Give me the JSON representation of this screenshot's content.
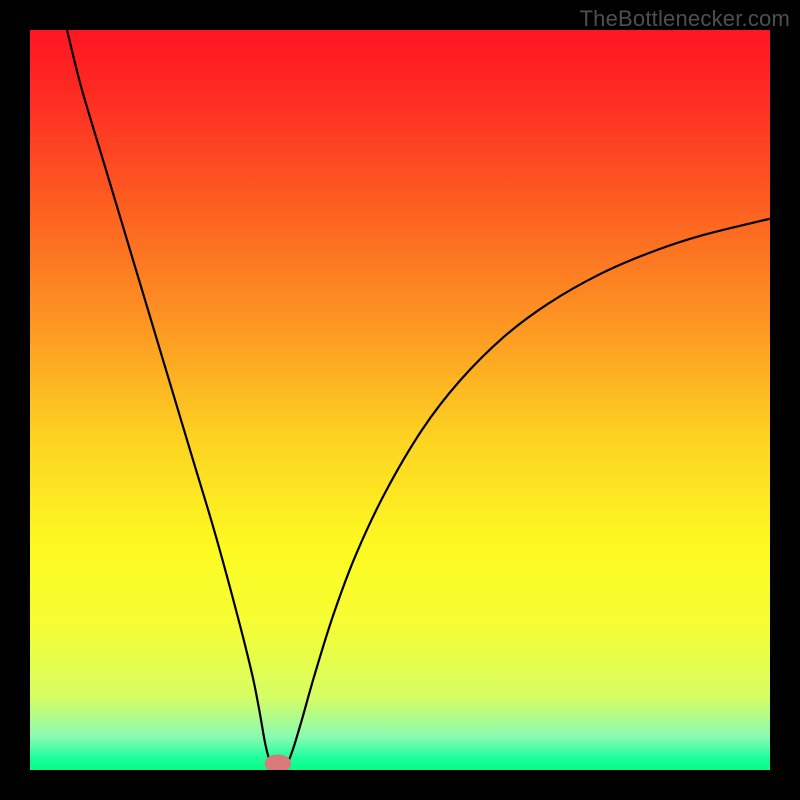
{
  "watermark": "TheBottlenecker.com",
  "chart_data": {
    "type": "line",
    "title": "",
    "xlabel": "",
    "ylabel": "",
    "xlim": [
      0,
      100
    ],
    "ylim": [
      0,
      100
    ],
    "background_gradient": {
      "stops": [
        {
          "offset": 0.0,
          "color": "#fe1522"
        },
        {
          "offset": 0.1,
          "color": "#fe2f22"
        },
        {
          "offset": 0.25,
          "color": "#fd6321"
        },
        {
          "offset": 0.4,
          "color": "#fd9722"
        },
        {
          "offset": 0.55,
          "color": "#fdd222"
        },
        {
          "offset": 0.7,
          "color": "#fdfa22"
        },
        {
          "offset": 0.8,
          "color": "#f6fd33"
        },
        {
          "offset": 0.9,
          "color": "#d7fd62"
        },
        {
          "offset": 0.955,
          "color": "#88fbb1"
        },
        {
          "offset": 0.985,
          "color": "#1bfd9c"
        },
        {
          "offset": 1.0,
          "color": "#06fd86"
        }
      ]
    },
    "series": [
      {
        "name": "curve",
        "stroke": "#000000",
        "stroke_width": 2.2,
        "points": [
          {
            "x": 5.0,
            "y": 100.0
          },
          {
            "x": 7.0,
            "y": 92.0
          },
          {
            "x": 10.0,
            "y": 82.0
          },
          {
            "x": 13.0,
            "y": 72.0
          },
          {
            "x": 16.0,
            "y": 62.0
          },
          {
            "x": 19.0,
            "y": 52.0
          },
          {
            "x": 22.0,
            "y": 42.0
          },
          {
            "x": 25.0,
            "y": 32.0
          },
          {
            "x": 28.0,
            "y": 21.0
          },
          {
            "x": 30.0,
            "y": 13.0
          },
          {
            "x": 31.0,
            "y": 8.0
          },
          {
            "x": 31.8,
            "y": 3.5
          },
          {
            "x": 32.5,
            "y": 1.0
          },
          {
            "x": 33.2,
            "y": 0.4
          },
          {
            "x": 34.0,
            "y": 0.4
          },
          {
            "x": 34.8,
            "y": 1.0
          },
          {
            "x": 35.6,
            "y": 3.0
          },
          {
            "x": 36.8,
            "y": 7.0
          },
          {
            "x": 38.5,
            "y": 13.0
          },
          {
            "x": 41.0,
            "y": 21.0
          },
          {
            "x": 44.0,
            "y": 29.0
          },
          {
            "x": 48.0,
            "y": 37.5
          },
          {
            "x": 53.0,
            "y": 46.0
          },
          {
            "x": 58.0,
            "y": 52.5
          },
          {
            "x": 64.0,
            "y": 58.5
          },
          {
            "x": 70.0,
            "y": 63.0
          },
          {
            "x": 77.0,
            "y": 67.0
          },
          {
            "x": 84.0,
            "y": 70.0
          },
          {
            "x": 91.0,
            "y": 72.3
          },
          {
            "x": 100.0,
            "y": 74.5
          }
        ]
      }
    ],
    "marker": {
      "x": 33.5,
      "y": 0.9,
      "rx": 1.8,
      "ry": 1.2,
      "fill": "#d97a7a"
    }
  }
}
